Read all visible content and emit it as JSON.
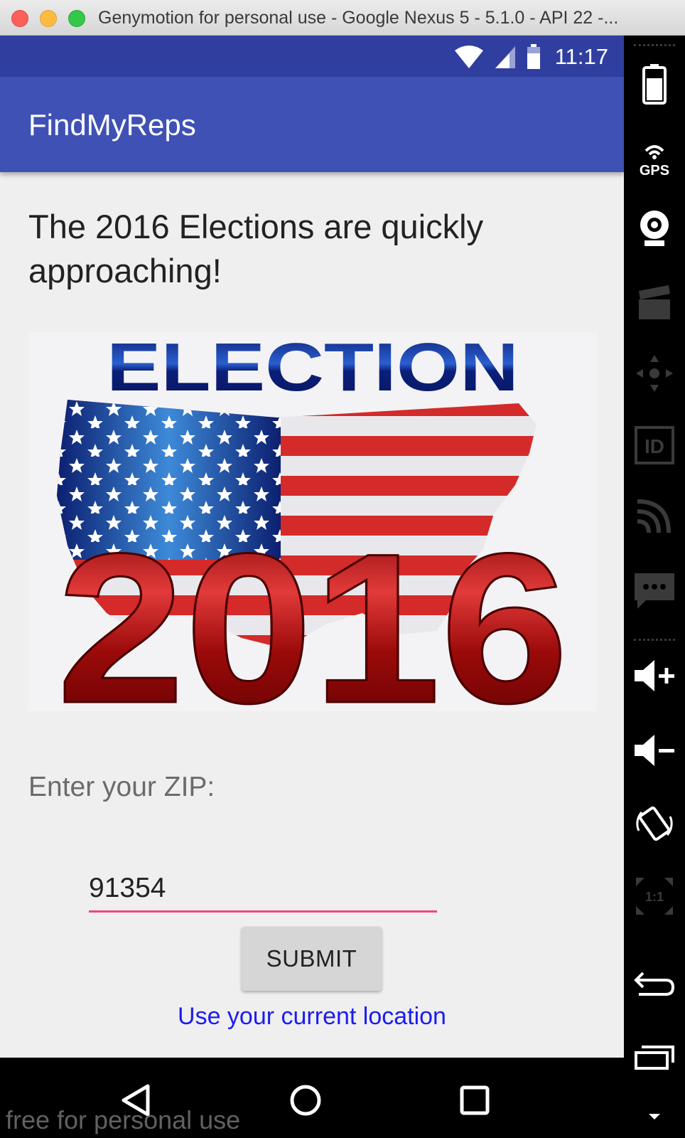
{
  "window": {
    "title": "Genymotion for personal use - Google Nexus 5 - 5.1.0 - API 22 -..."
  },
  "statusbar": {
    "time": "11:17"
  },
  "appbar": {
    "title": "FindMyReps"
  },
  "content": {
    "heading": "The 2016 Elections are quickly approaching!",
    "banner": {
      "word": "ELECTION",
      "year": "2016"
    },
    "zip_label": "Enter your ZIP:",
    "zip_value": "91354",
    "submit_label": "SUBMIT",
    "location_link": "Use your current location"
  },
  "watermark": "free for personal use",
  "sidepanel": {
    "gps_label": "GPS",
    "id_label": "ID",
    "ratio_label": "1:1"
  },
  "colors": {
    "statusbar": "#303f9f",
    "appbar": "#3f51b5",
    "accent": "#f0487a",
    "link": "#1c1cf0"
  }
}
